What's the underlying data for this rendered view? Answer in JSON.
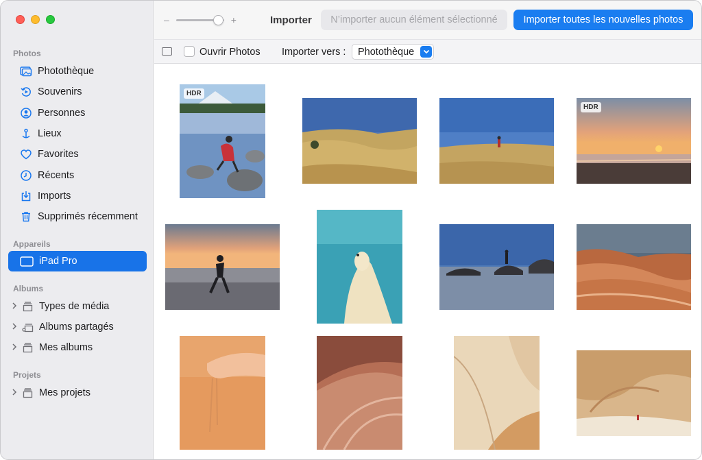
{
  "sidebar": {
    "sections": {
      "photos": "Photos",
      "devices": "Appareils",
      "albums": "Albums",
      "projects": "Projets"
    },
    "photos_items": [
      {
        "label": "Photothèque",
        "icon": "photos-library-icon"
      },
      {
        "label": "Souvenirs",
        "icon": "memories-icon"
      },
      {
        "label": "Personnes",
        "icon": "people-icon"
      },
      {
        "label": "Lieux",
        "icon": "places-icon"
      },
      {
        "label": "Favorites",
        "icon": "heart-icon"
      },
      {
        "label": "Récents",
        "icon": "clock-icon"
      },
      {
        "label": "Imports",
        "icon": "import-icon"
      },
      {
        "label": "Supprimés récemment",
        "icon": "trash-icon"
      }
    ],
    "device_item": {
      "label": "iPad Pro",
      "icon": "ipad-icon"
    },
    "album_items": [
      {
        "label": "Types de média",
        "icon": "folder-icon"
      },
      {
        "label": "Albums partagés",
        "icon": "shared-album-icon"
      },
      {
        "label": "Mes albums",
        "icon": "folder-icon"
      }
    ],
    "project_items": [
      {
        "label": "Mes projets",
        "icon": "folder-icon"
      }
    ]
  },
  "toolbar": {
    "zoom_minus": "–",
    "zoom_plus": "+",
    "zoom_level": 0.85,
    "title": "Importer",
    "import_selected_label": "N’importer aucun élément sélectionné",
    "import_all_label": "Importer toutes les nouvelles photos"
  },
  "options": {
    "open_photos_label": "Ouvrir Photos",
    "open_photos_checked": false,
    "import_to_label": "Importer vers :",
    "import_to_value": "Photothèque"
  },
  "photos": [
    {
      "name": "lake-mountain-photo",
      "badge": "HDR"
    },
    {
      "name": "grass-hill-photo",
      "badge": ""
    },
    {
      "name": "person-grass-photo",
      "badge": ""
    },
    {
      "name": "sunset-beach-photo",
      "badge": "HDR"
    },
    {
      "name": "beach-runner-photo",
      "badge": ""
    },
    {
      "name": "dog-pool-photo",
      "badge": ""
    },
    {
      "name": "rock-sea-photo",
      "badge": ""
    },
    {
      "name": "wave-rock-photo",
      "badge": ""
    },
    {
      "name": "sand-hand-photo",
      "badge": ""
    },
    {
      "name": "striped-rock-photo",
      "badge": ""
    },
    {
      "name": "sandstone-curve-photo",
      "badge": ""
    },
    {
      "name": "canyon-cave-photo",
      "badge": ""
    }
  ],
  "colors": {
    "accent": "#1a7df0",
    "selection": "#1873e8",
    "sidebar_bg": "#ececef"
  }
}
